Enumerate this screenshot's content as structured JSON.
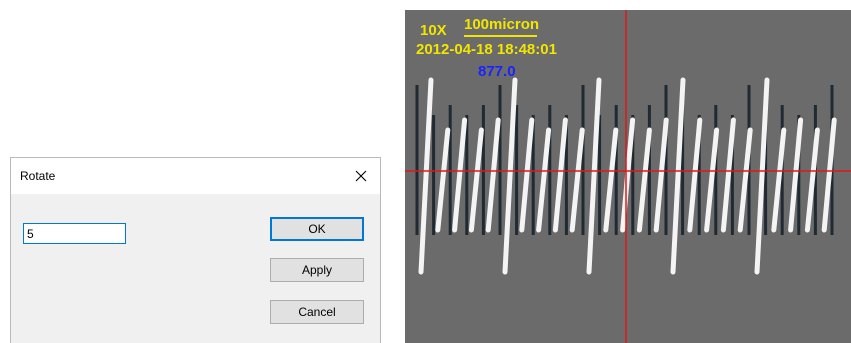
{
  "dialog": {
    "title": "Rotate",
    "close_icon": "close-icon",
    "angle_value": "5",
    "buttons": {
      "ok": "OK",
      "apply": "Apply",
      "cancel": "Cancel"
    }
  },
  "image": {
    "magnification": "10X",
    "scale_label": "100micron",
    "datetime": "2012-04-18 18:48:01",
    "measurement": "877.0",
    "colors": {
      "overlay_text": "#f2e600",
      "measurement_text": "#1a22ff",
      "crosshair": "#e01818",
      "background": "#6b6b6b"
    }
  }
}
